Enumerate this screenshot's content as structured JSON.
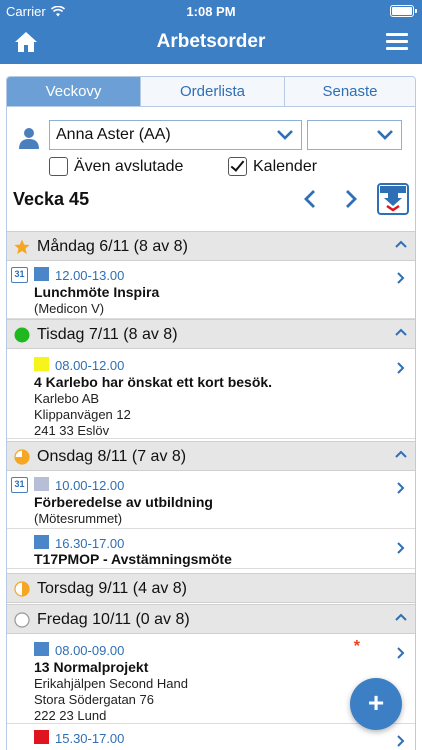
{
  "status": {
    "carrier": "Carrier",
    "time": "1:08 PM"
  },
  "nav": {
    "title": "Arbetsorder"
  },
  "tabs": [
    "Veckovy",
    "Orderlista",
    "Senaste"
  ],
  "filter": {
    "user": "Anna Aster (AA)",
    "secondary": "",
    "include_closed_label": "Även avslutade",
    "include_closed": false,
    "calendar_label": "Kalender",
    "calendar": true
  },
  "week": {
    "title": "Vecka 45"
  },
  "days": [
    {
      "label": "Måndag 6/11 (8 av 8)",
      "icon": "star-icon",
      "color": "#f5a623"
    },
    {
      "label": "Tisdag 7/11 (8 av 8)",
      "icon": "status-full-icon",
      "color": "#20b820"
    },
    {
      "label": "Onsdag 8/11 (7 av 8)",
      "icon": "status-partial-icon",
      "color": "#f5a623"
    },
    {
      "label": "Torsdag 9/11 (4 av 8)",
      "icon": "status-half-icon",
      "color": "#f5a623"
    },
    {
      "label": "Fredag 10/11 (0 av 8)",
      "icon": "status-empty-icon",
      "color": "#999999"
    }
  ],
  "appointments": {
    "mon_1": {
      "time": "12.00-13.00",
      "title": "Lunchmöte Inspira",
      "lines": [
        "(Medicon V)"
      ],
      "color": "#4a86c8",
      "calendar": true
    },
    "tue_1": {
      "time": "08.00-12.00",
      "title": "4 Karlebo har önskat ett kort besök.",
      "lines": [
        "Karlebo AB",
        "Klippanvägen 12",
        "241 33 Eslöv"
      ],
      "color": "#f5f51c",
      "calendar": false
    },
    "wed_1": {
      "time": "10.00-12.00",
      "title": "Förberedelse av utbildning",
      "lines": [
        "(Mötesrummet)"
      ],
      "color": "#b6bfd6",
      "calendar": true
    },
    "wed_2": {
      "time": "16.30-17.00",
      "title": "T17PMOP - Avstämningsmöte",
      "lines": [],
      "color": "#4a86c8",
      "calendar": false
    },
    "fri_1": {
      "time": "08.00-09.00",
      "title": "13 Normalprojekt",
      "lines": [
        "Erikahjälpen Second Hand",
        "Stora Södergatan 76",
        "222 23 Lund"
      ],
      "color": "#4a86c8",
      "calendar": false,
      "flag": "*"
    },
    "fri_2": {
      "time": "15.30-17.00",
      "title": "",
      "lines": [],
      "color": "#e0141e",
      "calendar": false
    }
  },
  "calendar_icon_text": "31",
  "fab": {
    "label": "+"
  }
}
